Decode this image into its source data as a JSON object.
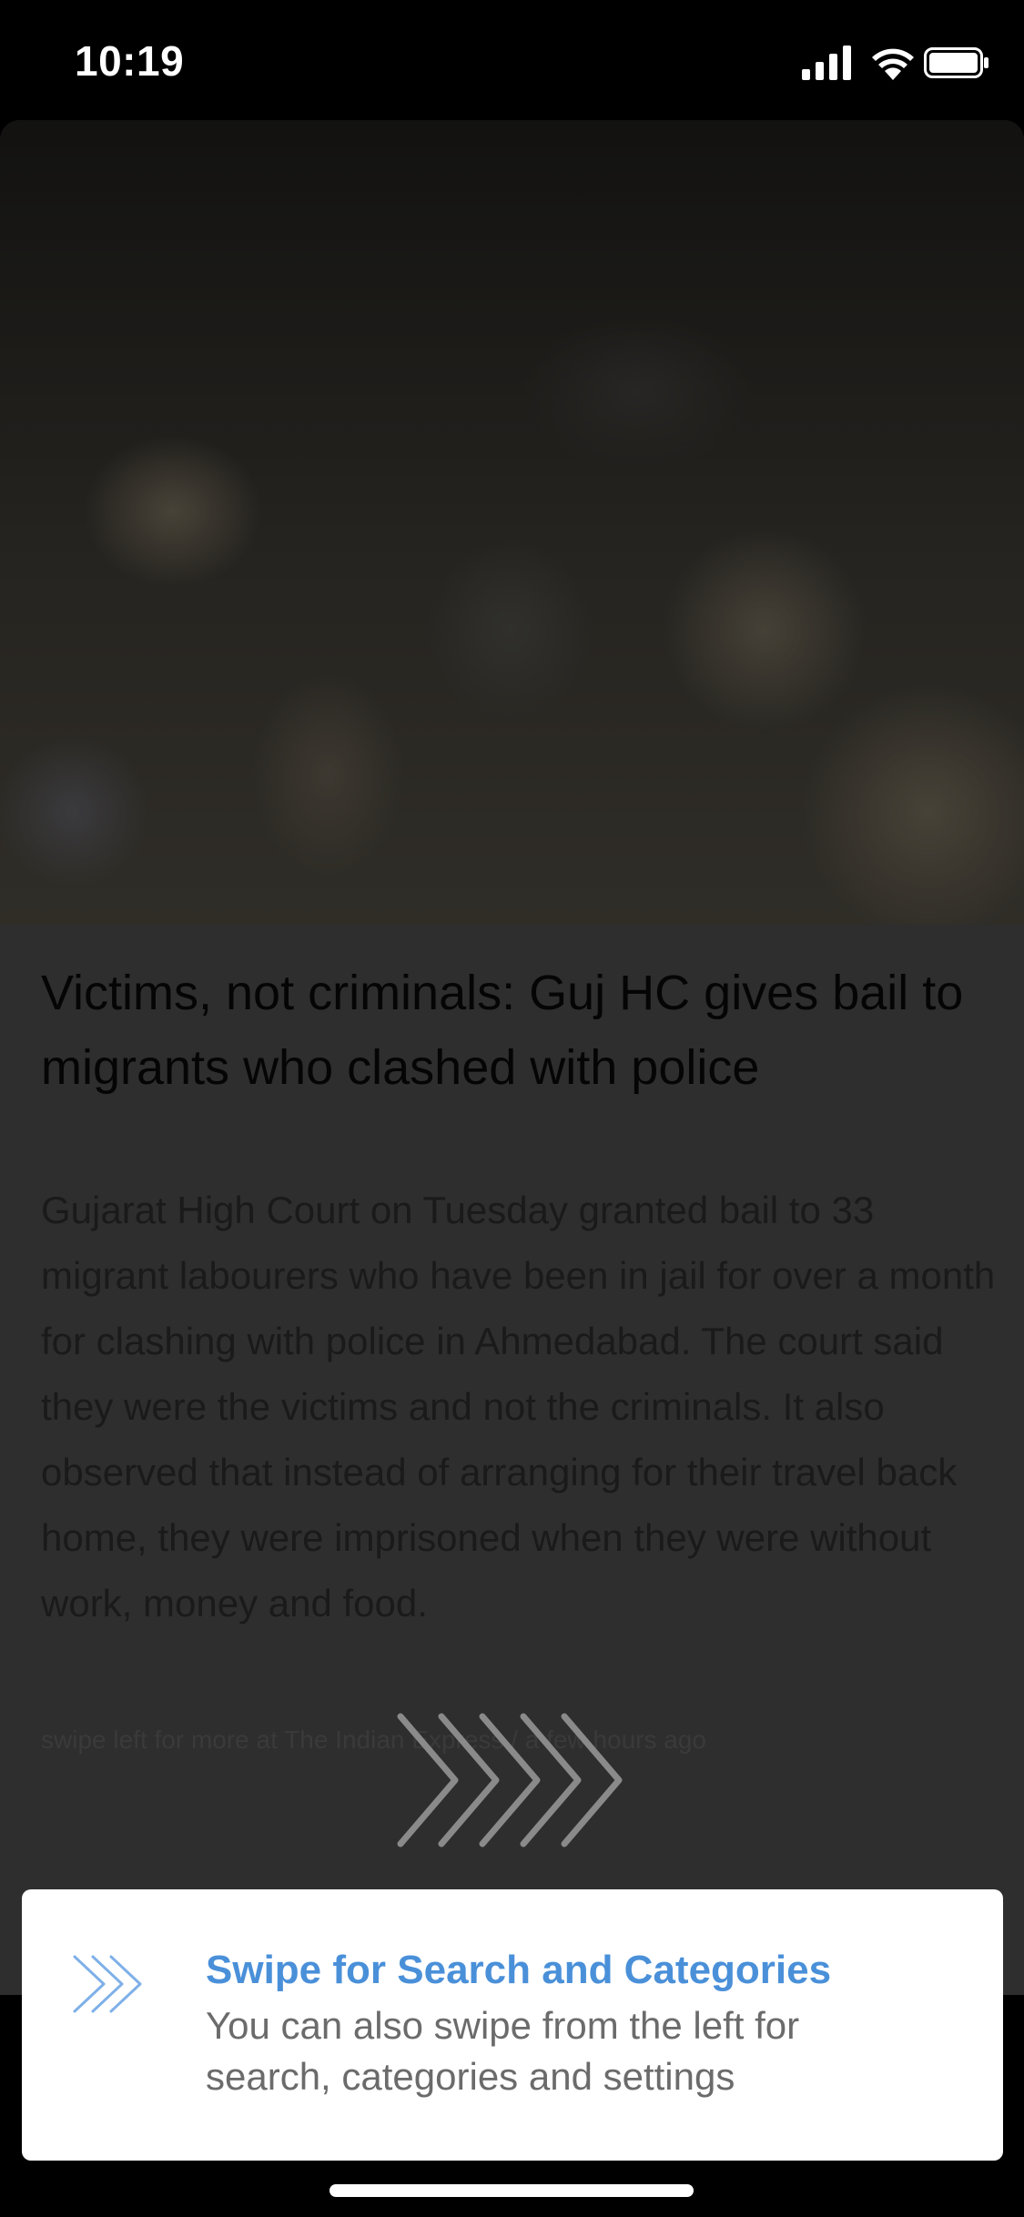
{
  "status_bar": {
    "time": "10:19"
  },
  "article": {
    "headline": "Victims, not criminals: Guj HC gives bail to migrants who clashed with police",
    "summary": "Gujarat High Court on Tuesday granted bail to 33 migrant labourers who have been in jail for over a month for clashing with police in Ahmedabad. The court said they were the victims and not the criminals. It also observed that instead of arranging for their travel back home, they were imprisoned when they were without work, money and food.",
    "source_line": "swipe left for more at The Indian Express / a few hours ago"
  },
  "tip": {
    "title": "Swipe for Search and Categories",
    "body": "You can also swipe from the left for search, categories and settings"
  },
  "colors": {
    "accent": "#4a90d9",
    "overlay": "#2e2e2e"
  },
  "icons": [
    "signal-icon",
    "wifi-icon",
    "battery-icon",
    "swipe-arrows-icon"
  ]
}
